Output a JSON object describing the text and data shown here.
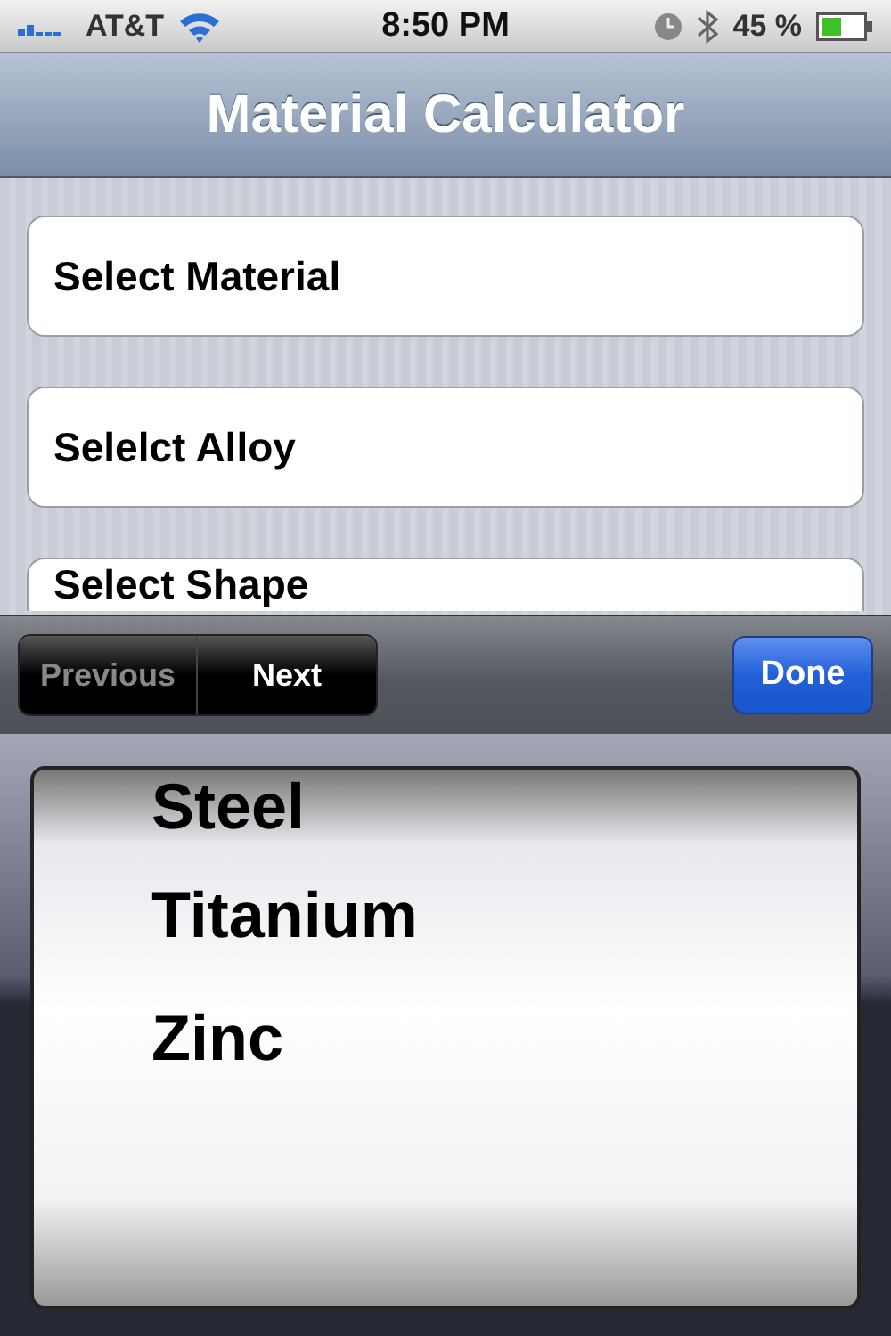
{
  "status_bar": {
    "carrier": "AT&T",
    "time": "8:50 PM",
    "battery": "45 %"
  },
  "nav_bar": {
    "title": "Material Calculator"
  },
  "fields": [
    {
      "label": "Select Material"
    },
    {
      "label": "Selelct Alloy"
    },
    {
      "label": "Select Shape"
    }
  ],
  "toolbar": {
    "buttons": [
      {
        "label": "Previous",
        "disabled": true
      },
      {
        "label": "Next",
        "disabled": false
      }
    ],
    "done": "Done"
  },
  "picker": {
    "items": [
      "Steel",
      "Titanium",
      "Zinc"
    ]
  }
}
